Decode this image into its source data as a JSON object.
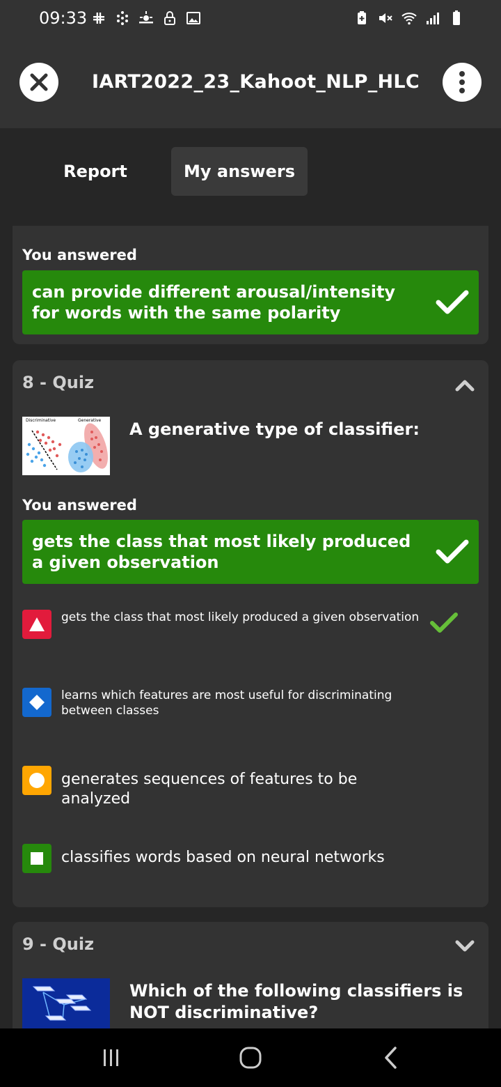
{
  "status": {
    "time": "09:33",
    "left_icons": [
      "slack-icon",
      "dots-grid-icon",
      "weather-icon",
      "lock-icon",
      "image-icon"
    ],
    "right_icons": [
      "battery-saver-icon",
      "mute-icon",
      "wifi-icon",
      "signal-icon",
      "battery-icon"
    ]
  },
  "header": {
    "title": "IART2022_23_Kahoot_NLP_HLC"
  },
  "tabs": [
    {
      "label": "Report",
      "active": false
    },
    {
      "label": "My answers",
      "active": true
    }
  ],
  "prev_card": {
    "you_answered_label": "You answered",
    "answer": "can provide different arousal/intensity for words with the same polarity"
  },
  "q8": {
    "heading": "8 - Quiz",
    "thumb_labels": [
      "Discriminative",
      "Generative"
    ],
    "question": "A generative type of classifier:",
    "you_answered_label": "You answered",
    "answer": "gets the class that most likely produced a given observation",
    "options": [
      {
        "text": "gets the class that most likely produced a given observation",
        "color": "#e21b3c",
        "shape": "triangle-icon",
        "correct": true
      },
      {
        "text": "learns which features are most useful for discriminating between classes",
        "color": "#1368ce",
        "shape": "diamond-icon",
        "correct": false
      },
      {
        "text": "generates sequences of features to be analyzed",
        "color": "#ffa602",
        "shape": "circle-icon",
        "correct": false
      },
      {
        "text": "classifies words based on neural networks",
        "color": "#26890c",
        "shape": "square-icon",
        "correct": false
      }
    ]
  },
  "q9": {
    "heading": "9 - Quiz",
    "question": "Which of the following classifiers is NOT discriminative?"
  },
  "colors": {
    "correct_green": "#26890c",
    "check_green": "#66bf39",
    "background": "#262626",
    "card": "#333333"
  }
}
